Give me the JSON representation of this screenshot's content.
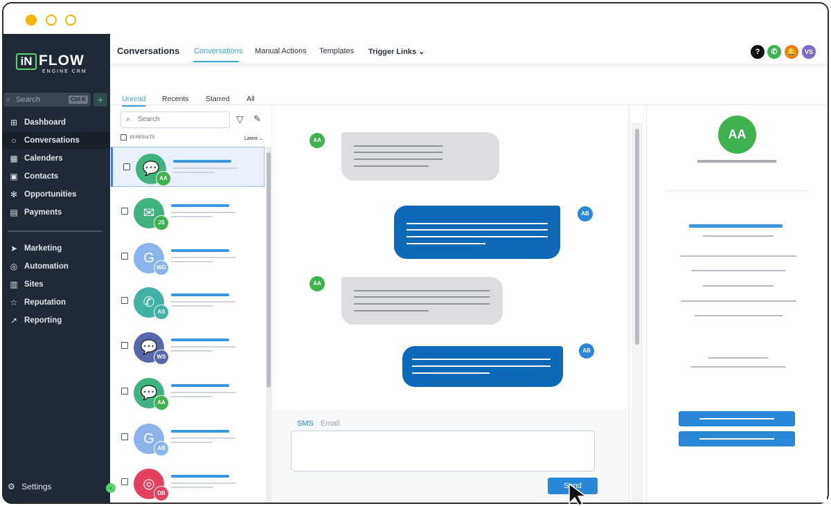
{
  "window": {
    "title_dots": [
      "#f2b705",
      "#ffffff",
      "#ffffff"
    ]
  },
  "brand": {
    "logo_box": "iN",
    "logo_word": "FLOW",
    "logo_sub": "ENGINE CRM",
    "accent": "#5ad26b"
  },
  "sidebar": {
    "search_placeholder": "Search",
    "search_shortcut": "Ctrl K",
    "add_label": "+",
    "items": [
      {
        "label": "Dashboard",
        "icon": "dashboard-icon",
        "glyph": "⊞"
      },
      {
        "label": "Conversations",
        "icon": "chat-bubble-icon",
        "glyph": "○"
      },
      {
        "label": "Calenders",
        "icon": "calendar-icon",
        "glyph": "▦"
      },
      {
        "label": "Contacts",
        "icon": "contacts-icon",
        "glyph": "▣"
      },
      {
        "label": "Opportunities",
        "icon": "opportunities-icon",
        "glyph": "✻"
      },
      {
        "label": "Payments",
        "icon": "payments-icon",
        "glyph": "▤"
      },
      {
        "label": "Marketing",
        "icon": "send-icon",
        "glyph": "➤"
      },
      {
        "label": "Automation",
        "icon": "automation-icon",
        "glyph": "◎"
      },
      {
        "label": "Sites",
        "icon": "sites-icon",
        "glyph": "▥"
      },
      {
        "label": "Reputation",
        "icon": "star-icon",
        "glyph": "☆"
      },
      {
        "label": "Reporting",
        "icon": "trend-icon",
        "glyph": "↗"
      }
    ],
    "settings_label": "Settings",
    "settings_glyph": "⚙",
    "collapse_glyph": "‹"
  },
  "topbar": {
    "title": "Conversations",
    "tabs": [
      "Conversations",
      "Manual Actions",
      "Templates",
      "Trigger Links"
    ],
    "trigger_chevron": "⌄",
    "icons": [
      {
        "name": "help-icon",
        "glyph": "?",
        "color": "#111111"
      },
      {
        "name": "phone-icon",
        "glyph": "✆",
        "color": "#3fb24f"
      },
      {
        "name": "bell-icon",
        "glyph": "🔔",
        "color": "#f07f16"
      },
      {
        "name": "user-avatar",
        "glyph": "VS",
        "color": "#7e69c3"
      }
    ]
  },
  "conversation_tabs": [
    "Unread",
    "Recents",
    "Starred",
    "All"
  ],
  "list": {
    "search_placeholder": "Search",
    "results_label": "83 RESULTS",
    "sort_label": "Latest ⌄",
    "rows": [
      {
        "channel": "chat",
        "glyph": "💬",
        "avatar_color": "#3fb27f",
        "initials": "AA",
        "badge_color": "#3fb24f"
      },
      {
        "channel": "email",
        "glyph": "✉",
        "avatar_color": "#3fb27f",
        "initials": "JS",
        "badge_color": "#3fb24f"
      },
      {
        "channel": "google-business",
        "glyph": "G",
        "avatar_color": "#8ab4ea",
        "initials": "WG",
        "badge_color": "#8ab4ea"
      },
      {
        "channel": "phone",
        "glyph": "✆",
        "avatar_color": "#3fb2a3",
        "initials": "AS",
        "badge_color": "#3fb2a3"
      },
      {
        "channel": "messenger",
        "glyph": "💬",
        "avatar_color": "#5767a9",
        "initials": "WS",
        "badge_color": "#5767a9"
      },
      {
        "channel": "chat",
        "glyph": "💬",
        "avatar_color": "#3fb27f",
        "initials": "AA",
        "badge_color": "#3fb24f"
      },
      {
        "channel": "google-business",
        "glyph": "G",
        "avatar_color": "#8ab4ea",
        "initials": "AB",
        "badge_color": "#8ab4ea"
      },
      {
        "channel": "instagram",
        "glyph": "◎",
        "avatar_color": "#e4405f",
        "initials": "DB",
        "badge_color": "#e4405f"
      }
    ]
  },
  "chat": {
    "messages": [
      {
        "direction": "in",
        "initials": "AA",
        "color": "#3fb24f"
      },
      {
        "direction": "out",
        "initials": "AB",
        "color": "#2a86d6"
      },
      {
        "direction": "in",
        "initials": "AA",
        "color": "#3fb24f"
      },
      {
        "direction": "out",
        "initials": "AB",
        "color": "#2a86d6"
      }
    ],
    "composer_tabs": [
      "SMS",
      "Email"
    ],
    "send_label": "Send"
  },
  "contact_panel": {
    "initials": "AA",
    "color": "#3fb24f"
  }
}
